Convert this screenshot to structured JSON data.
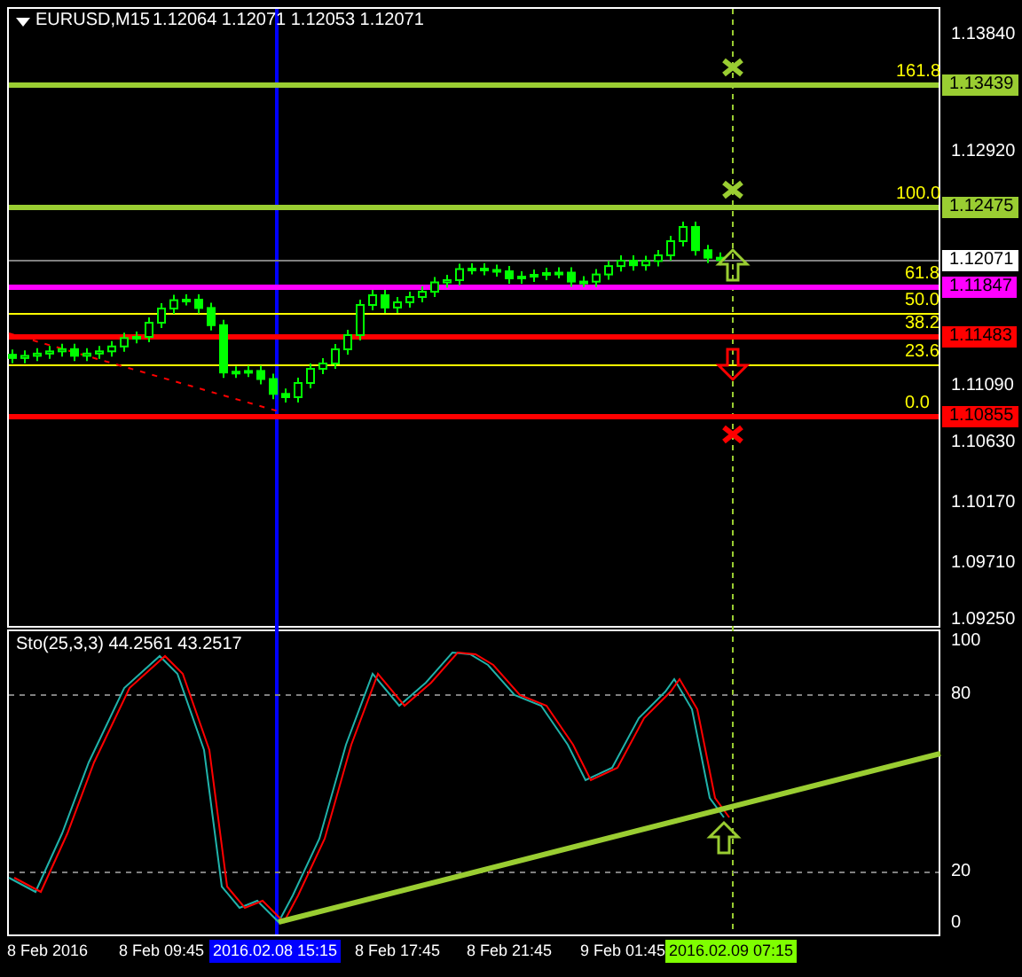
{
  "header": {
    "symbol": "EURUSD,M15",
    "prices": "1.12064 1.12071 1.12053 1.12071"
  },
  "price_axis": [
    "1.13840",
    "1.12920",
    "1.11090",
    "1.10630",
    "1.10170",
    "1.09710",
    "1.09250"
  ],
  "levels": [
    {
      "label": "161.8",
      "tag": "1.13439",
      "color": "#9acd32"
    },
    {
      "label": "100.0",
      "tag": "1.12475",
      "color": "#9acd32"
    },
    {
      "tag": "1.12071",
      "color": "#ffffff"
    },
    {
      "label": "61.8",
      "tag": "1.11847",
      "color": "#ff00ff"
    },
    {
      "label": "50.0",
      "color": "#ffff00"
    },
    {
      "label": "38.2",
      "tag": "1.11483",
      "color": "#ff0000"
    },
    {
      "label": "23.6",
      "color": "#ffff00"
    },
    {
      "label": "0.0",
      "tag": "1.10855",
      "color": "#ff0000"
    }
  ],
  "indicator": {
    "label": "Sto(25,3,3) 44.2561 43.2517",
    "axis": [
      "100",
      "80",
      "20",
      "0"
    ]
  },
  "time_axis": [
    {
      "text": "8 Feb 2016",
      "kind": "plain"
    },
    {
      "text": "8 Feb 09:45",
      "kind": "plain"
    },
    {
      "text": "2016.02.08 15:15",
      "kind": "highlight",
      "color": "#0000ff"
    },
    {
      "text": "8 Feb 17:45",
      "kind": "plain"
    },
    {
      "text": "8 Feb 21:45",
      "kind": "plain"
    },
    {
      "text": "9 Feb 01:45",
      "kind": "plain"
    },
    {
      "text": "2016.02.09 07:15",
      "kind": "highlight",
      "color": "#7fff00"
    }
  ]
}
